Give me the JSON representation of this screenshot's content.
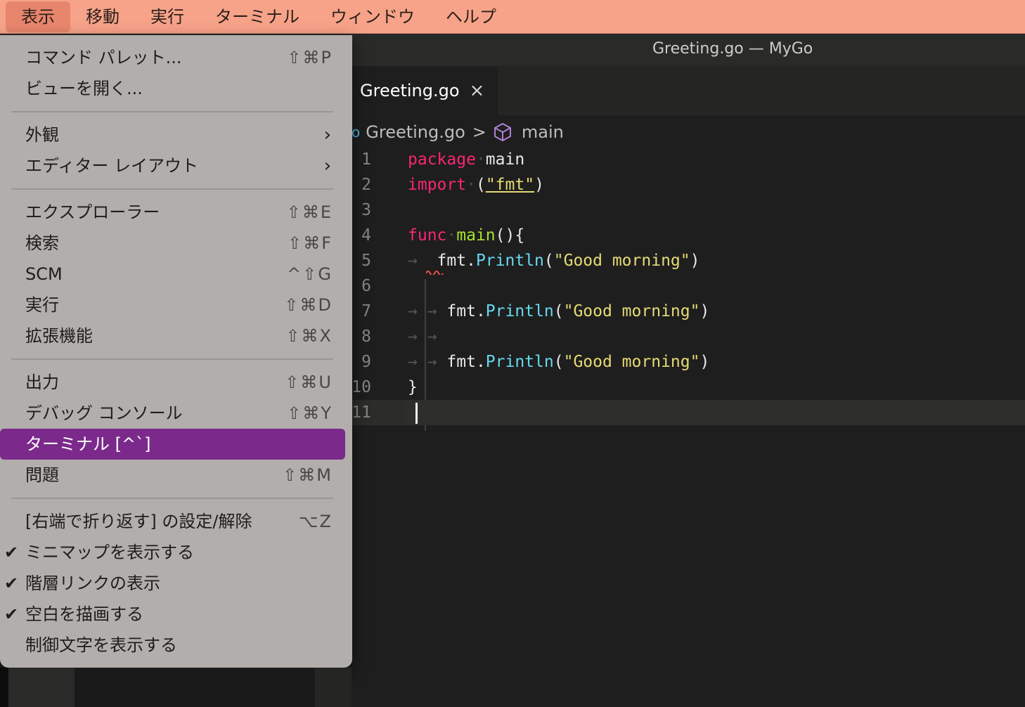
{
  "menubar": {
    "items": [
      "表示",
      "移動",
      "実行",
      "ターミナル",
      "ウィンドウ",
      "ヘルプ"
    ]
  },
  "window": {
    "title": "Greeting.go — MyGo"
  },
  "tab": {
    "label": "Greeting.go",
    "close": "×"
  },
  "breadcrumbs": {
    "file": "Greeting.go",
    "symbol": "main"
  },
  "code": {
    "line_numbers": [
      "1",
      "2",
      "3",
      "4",
      "5",
      "6",
      "7",
      "8",
      "9",
      "10",
      "11"
    ],
    "package_kw": "package",
    "package_name": "main",
    "import_kw": "import",
    "import_open": "(",
    "import_str": "\"fmt\"",
    "import_close": ")",
    "func_kw": "func",
    "func_name": "main",
    "func_sig": "(){",
    "obj": "fmt",
    "dot": ".",
    "method": "Println",
    "paren_open": "(",
    "paren_close": ")",
    "string": "\"Good morning\"",
    "close_brace": "}"
  },
  "menu": {
    "items": [
      {
        "label": "コマンド パレット...",
        "shortcut": "⇧⌘P"
      },
      {
        "label": "ビューを開く...",
        "shortcut": ""
      },
      {
        "label": "外観",
        "submenu": "›"
      },
      {
        "label": "エディター レイアウト",
        "submenu": "›"
      },
      {
        "label": "エクスプローラー",
        "shortcut": "⇧⌘E"
      },
      {
        "label": "検索",
        "shortcut": "⇧⌘F"
      },
      {
        "label": "SCM",
        "shortcut": "^⇧G"
      },
      {
        "label": "実行",
        "shortcut": "⇧⌘D"
      },
      {
        "label": "拡張機能",
        "shortcut": "⇧⌘X"
      },
      {
        "label": "出力",
        "shortcut": "⇧⌘U"
      },
      {
        "label": "デバッグ コンソール",
        "shortcut": "⇧⌘Y"
      },
      {
        "label": "ターミナル [^`]",
        "shortcut": ""
      },
      {
        "label": "問題",
        "shortcut": "⇧⌘M"
      },
      {
        "label": "[右端で折り返す] の設定/解除",
        "shortcut": "⌥Z"
      },
      {
        "label": "ミニマップを表示する",
        "check": "✔"
      },
      {
        "label": "階層リンクの表示",
        "check": "✔"
      },
      {
        "label": "空白を描画する",
        "check": "✔"
      },
      {
        "label": "制御文字を表示する"
      }
    ]
  },
  "colors": {
    "menubar_bg": "#f7a389",
    "highlight": "#7b2a8c",
    "keyword": "#f92672",
    "function": "#a6e22e",
    "string": "#e6db74",
    "method": "#66d9ef"
  }
}
